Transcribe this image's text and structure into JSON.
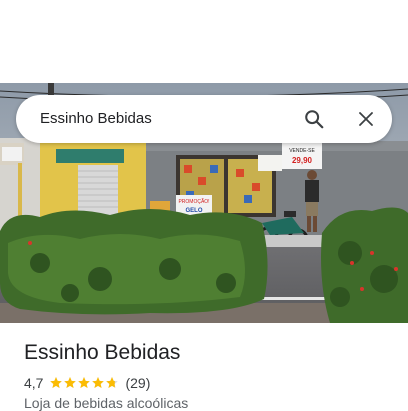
{
  "search": {
    "query": "Essinho Bebidas"
  },
  "place": {
    "name": "Essinho Bebidas",
    "rating": "4,7",
    "stars_value": 4.7,
    "stars_max": 5,
    "review_count": "(29)",
    "category": "Loja de bebidas alcoólicas"
  },
  "photo_signs": {
    "sign_promo": "PROMOÇÃO!",
    "sign_gelo": "GELO",
    "sign_price": "29,90",
    "sign_vende": "VENDE-SE"
  },
  "colors": {
    "star": "#fbbc04",
    "text": "#202124",
    "subtle": "#5f6368"
  }
}
